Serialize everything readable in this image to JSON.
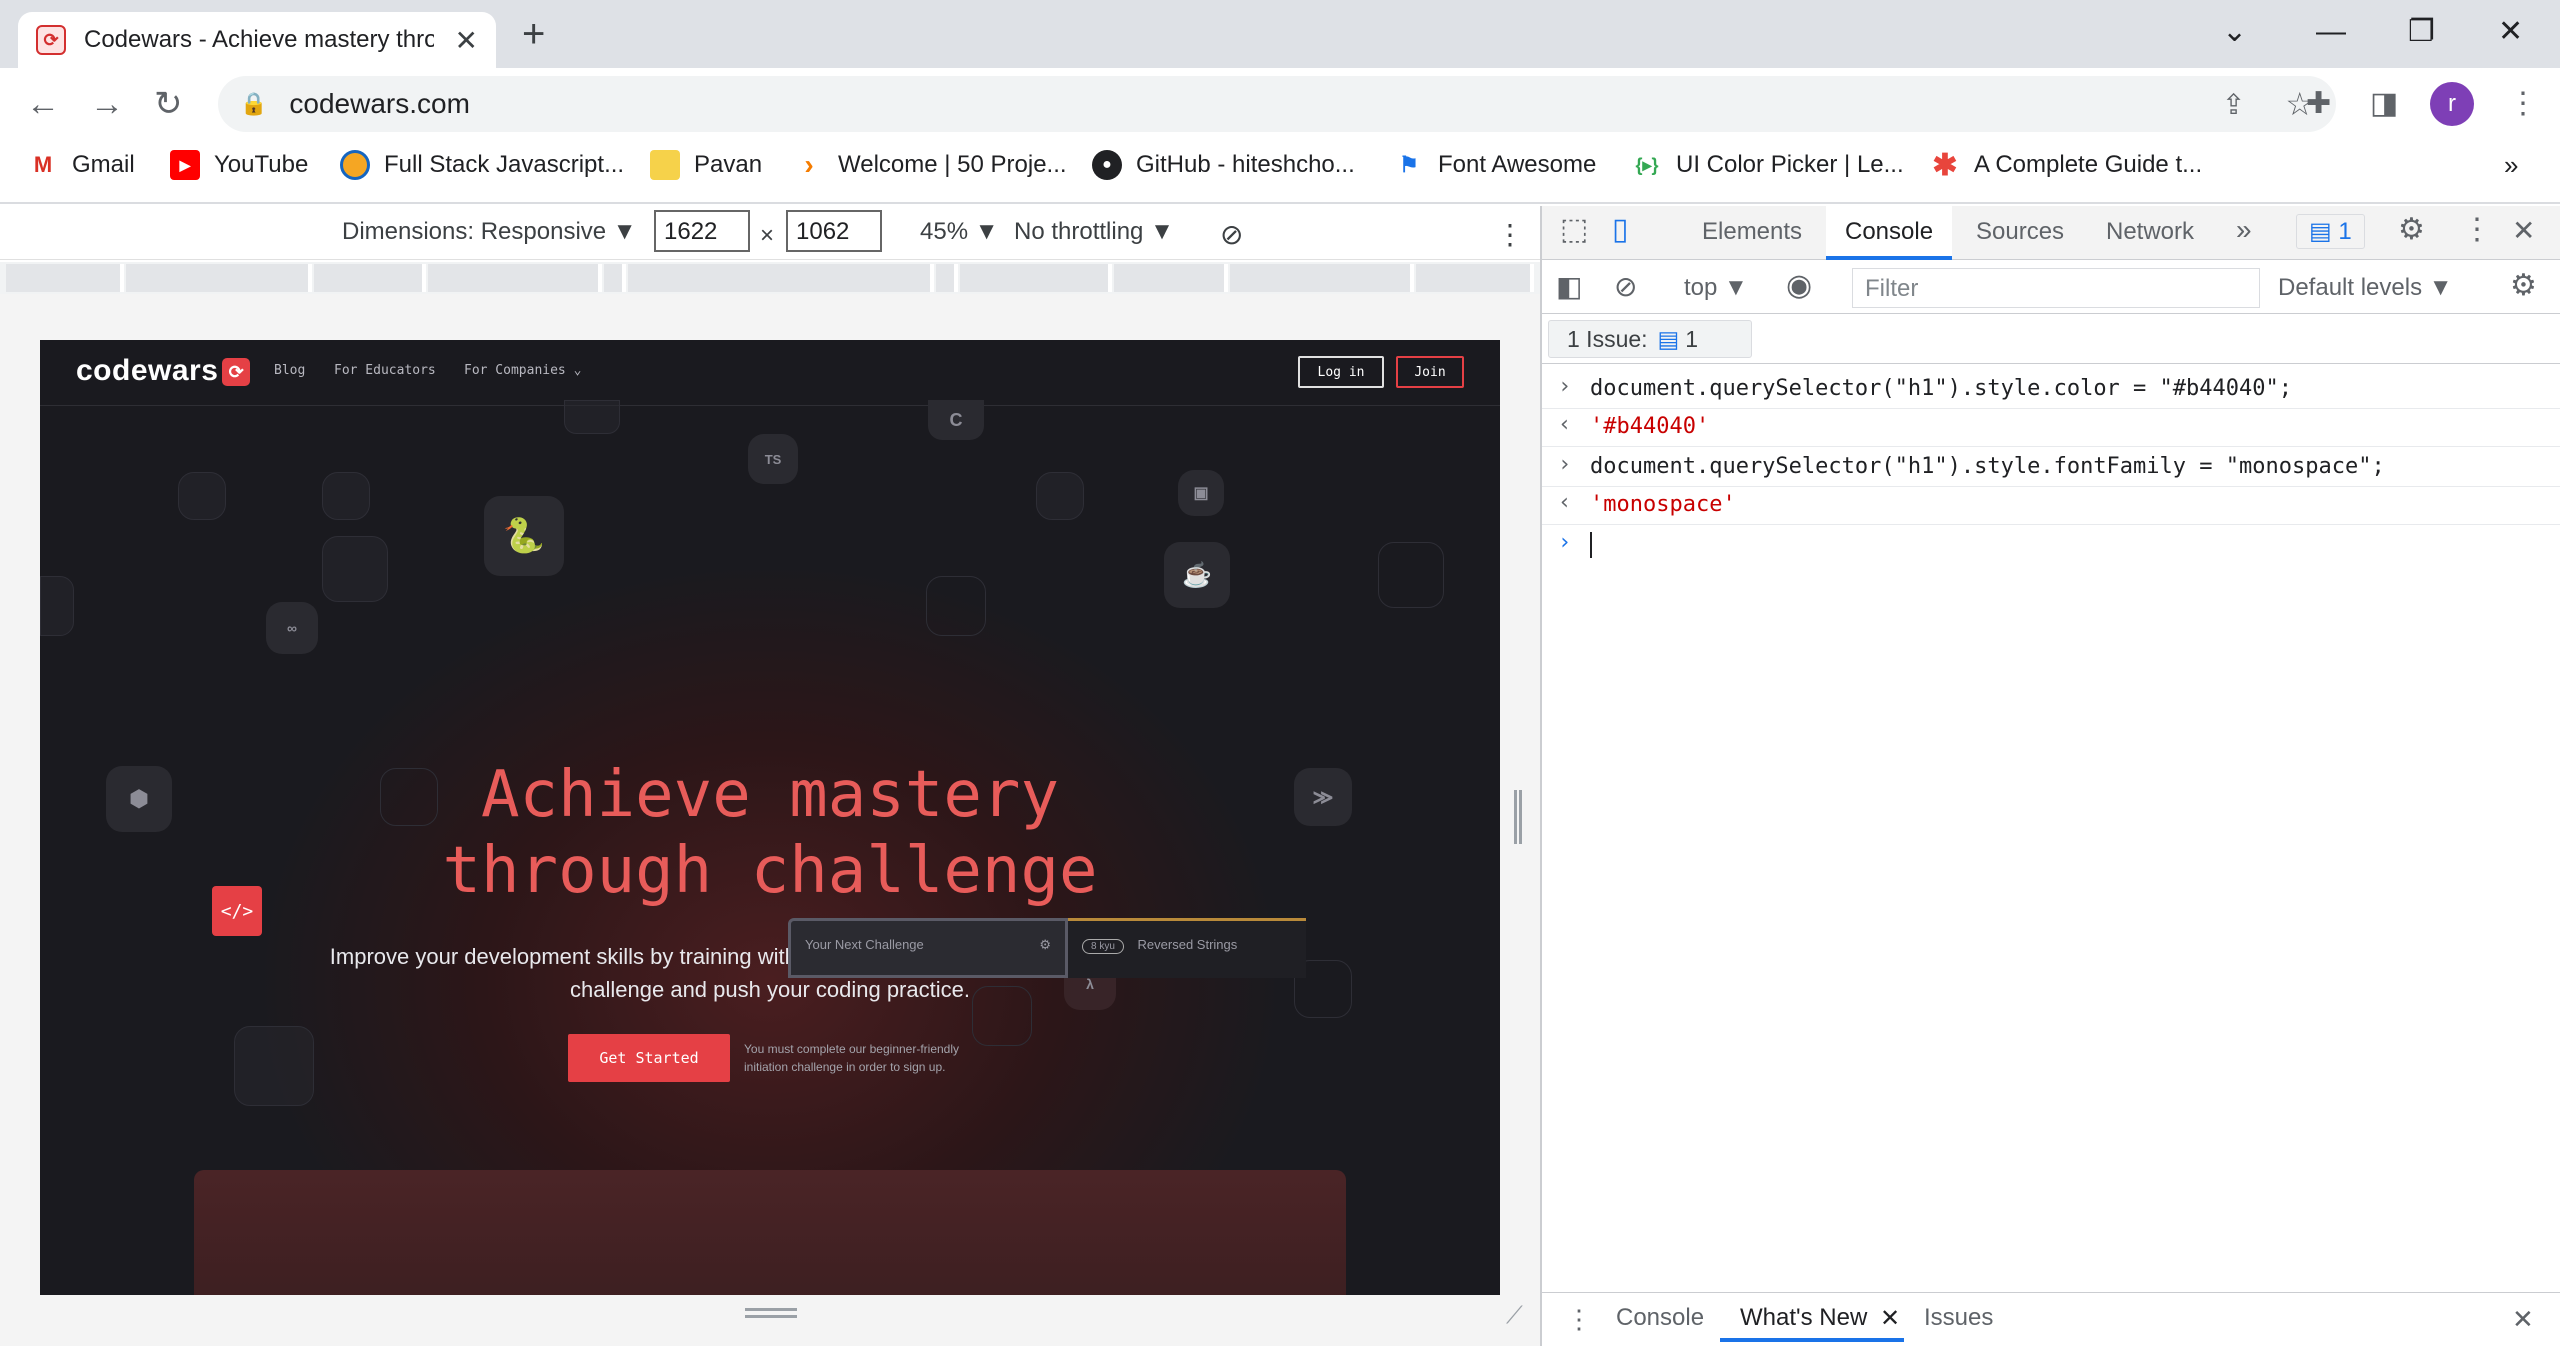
{
  "browser": {
    "tab_title": "Codewars - Achieve mastery thro",
    "url": "codewars.com",
    "avatar_letter": "r",
    "bookmarks": [
      {
        "label": "Gmail",
        "icon": "gmail-icon"
      },
      {
        "label": "YouTube",
        "icon": "youtube-icon"
      },
      {
        "label": "Full Stack Javascript...",
        "icon": "fullstack-icon"
      },
      {
        "label": "Pavan",
        "icon": "folder-icon"
      },
      {
        "label": "Welcome | 50 Proje...",
        "icon": "fifty-projects-icon"
      },
      {
        "label": "GitHub - hiteshcho...",
        "icon": "github-icon"
      },
      {
        "label": "Font Awesome",
        "icon": "font-awesome-icon"
      },
      {
        "label": "UI Color Picker | Le...",
        "icon": "ui-color-picker-icon"
      },
      {
        "label": "A Complete Guide t...",
        "icon": "complete-guide-icon"
      }
    ],
    "bookmarks_overflow": "»"
  },
  "device_toolbar": {
    "dimensions_label": "Dimensions: Responsive",
    "width": "1622",
    "times": "×",
    "height": "1062",
    "zoom": "45%",
    "throttling": "No throttling"
  },
  "codewars": {
    "logo": "codewars",
    "nav": [
      "Blog",
      "For Educators",
      "For Companies"
    ],
    "login": "Log in",
    "join": "Join",
    "hero_line1": "Achieve mastery",
    "hero_line2": "through challenge",
    "subtitle": "Improve your development skills by training with your peers on code kata that continuously challenge and push your coding practice.",
    "cta": "Get Started",
    "cta_note": "You must complete our beginner-friendly initiation challenge in order to sign up.",
    "card_icon": "</>",
    "next_challenge": "Your Next Challenge",
    "kata_rank": "8 kyu",
    "kata_name": "Reversed Strings"
  },
  "devtools": {
    "tabs": [
      "Elements",
      "Console",
      "Sources",
      "Network"
    ],
    "active_tab": "Console",
    "more_tabs": "»",
    "messages_count": "1",
    "context": "top",
    "filter_placeholder": "Filter",
    "levels": "Default levels",
    "issues_label": "1 Issue:",
    "issues_count": "1",
    "console": [
      {
        "type": "input",
        "code": "document.querySelector(\"h1\").style.color = \"#b44040\";"
      },
      {
        "type": "output",
        "value": "'#b44040'"
      },
      {
        "type": "input",
        "code": "document.querySelector(\"h1\").style.fontFamily = \"monospace\";"
      },
      {
        "type": "output",
        "value": "'monospace'"
      }
    ],
    "drawer_tabs": [
      "Console",
      "What's New",
      "Issues"
    ],
    "drawer_active": "What's New"
  },
  "colors": {
    "hero": "#e85c5a",
    "accent_red": "#e54045",
    "devtools_blue": "#1a73e8",
    "console_string": "#c80000"
  }
}
